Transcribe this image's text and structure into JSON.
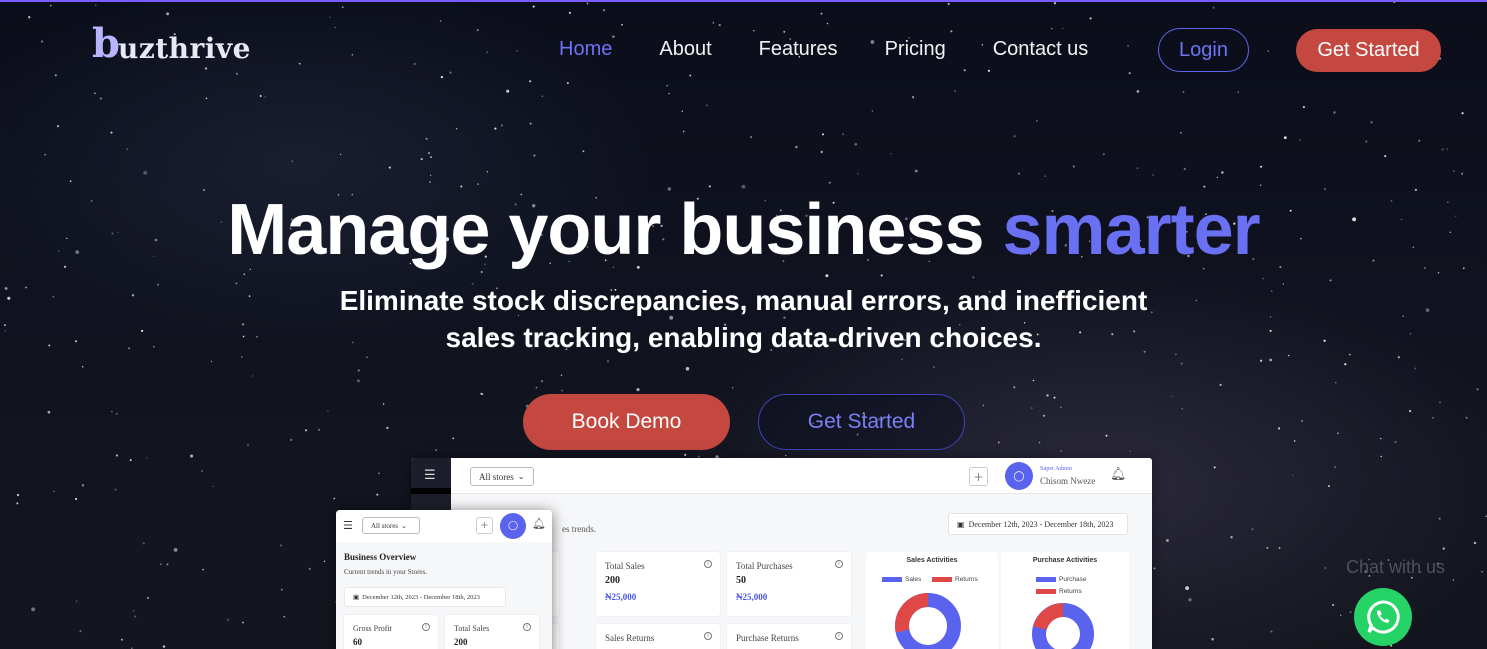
{
  "brand": {
    "logo_initial": "b",
    "logo_rest": "uzthrive"
  },
  "nav": {
    "links": [
      "Home",
      "About",
      "Features",
      "Pricing",
      "Contact us"
    ],
    "active": "Home",
    "login_label": "Login",
    "get_started_label": "Get Started"
  },
  "hero": {
    "title_main": "Manage your business ",
    "title_accent": "smarter",
    "subtitle_line1": "Eliminate stock discrepancies, manual errors, and inefficient",
    "subtitle_line2": "sales tracking, enabling data-driven choices.",
    "book_demo_label": "Book Demo",
    "get_started_label": "Get Started"
  },
  "dashboard": {
    "store_select": "All stores",
    "user_role": "Super Admin",
    "user_name": "Chisom Nweze",
    "date_range": "December 12th, 2023 - December 18th, 2023",
    "trends_fragment": "es trends.",
    "cards": [
      {
        "label": "Total Sales",
        "value": "200",
        "amount": "₦25,000"
      },
      {
        "label": "Total Purchases",
        "value": "50",
        "amount": "₦25,000"
      },
      {
        "label": "Sales Returns"
      },
      {
        "label": "Purchase Returns"
      }
    ],
    "sales_activities": {
      "title": "Sales Activities",
      "legend": [
        "Sales",
        "Returns"
      ]
    },
    "purchase_activities": {
      "title": "Purchase Activities",
      "legend": [
        "Purchase",
        "Returns"
      ]
    },
    "colors": {
      "primary": "#5a63ee",
      "returns": "#e04848"
    }
  },
  "mobile": {
    "store_select": "All stores",
    "overview_title": "Business Overview",
    "overview_sub": "Current trends in your Stores.",
    "date_range": "December 12th, 2023 - December 18th, 2023",
    "cards": [
      {
        "label": "Gross Profit",
        "value": "60"
      },
      {
        "label": "Total Sales",
        "value": "200"
      }
    ]
  },
  "chat": {
    "label": "Chat with us",
    "icon": "whatsapp-icon"
  },
  "colors": {
    "accent": "#6a70f2",
    "cta": "#c44840",
    "whatsapp": "#25d366"
  }
}
